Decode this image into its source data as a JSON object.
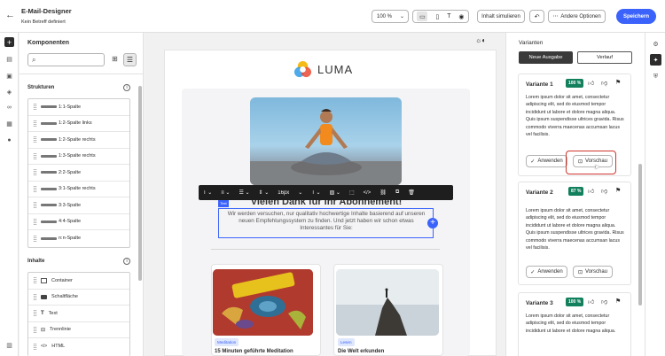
{
  "header": {
    "title": "E-Mail-Designer",
    "subtitle": "Kein Betreff definiert",
    "zoom": "100 %",
    "simulate_label": "Inhalt simulieren",
    "more_options_label": "Andere Optionen",
    "save_label": "Speichern"
  },
  "left_panel": {
    "title": "Komponenten",
    "search_placeholder": "",
    "structures_title": "Strukturen",
    "structures": [
      "1:1-Spalte",
      "1:2-Spalte links",
      "1:2-Spalte rechts",
      "1:3-Spalte rechts",
      "2:2-Spalte",
      "3:1-Spalte rechts",
      "3:3-Spalte",
      "4:4-Spalte",
      "n:n-Spalte"
    ],
    "contents_title": "Inhalte",
    "contents": [
      "Container",
      "Schaltfläche",
      "Text",
      "Trennlinie",
      "HTML"
    ]
  },
  "email": {
    "logo_text": "LUMA",
    "heading": "Vielen Dank für Ihr Abonnement!",
    "body": "Wir werden versuchen, nur qualitativ hochwertige Inhalte basierend auf unseren neuen Empfehlungssystem zu finden. Und jetzt haben wir schon etwas Interessantes für Sie:",
    "card1_tag": "Meditation",
    "card1_title": "15 Minuten geführte Meditation",
    "card2_tag": "Lesen",
    "card2_title": "Die Welt erkunden"
  },
  "format_bar": {
    "font_size": "16px"
  },
  "right_panel": {
    "title": "Varianten",
    "tab_new": "Neue Ausgabe",
    "tab_history": "Verlauf",
    "apply_label": "Anwenden",
    "preview_label": "Vorschau",
    "variants": [
      {
        "name": "Variante 1",
        "score": "100 %",
        "text": "Lorem ipsum dolor sit amet, consectetur adipiscing elit, sed do eiusmod tempor incididunt ut labore et dolore magna aliqua. Quis ipsum suspendisse ultrices gravida. Risus commodo viverra maecenas accumsan lacus vel facilisis."
      },
      {
        "name": "Variante 2",
        "score": "87 %",
        "text": "Lorem ipsum dolor sit amet, consectetur adipiscing elit, sed do eiusmod tempor incididunt ut labore et dolore magna aliqua. Quis ipsum suspendisse ultrices gravida. Risus commodo viverra maecenas accumsan lacus vel facilisis."
      },
      {
        "name": "Variante 3",
        "score": "100 %",
        "text": "Lorem ipsum dolor sit amet, consectetur adipiscing elit, sed do eiusmod tempor incididunt ut labore et dolore magna aliqua."
      }
    ]
  }
}
